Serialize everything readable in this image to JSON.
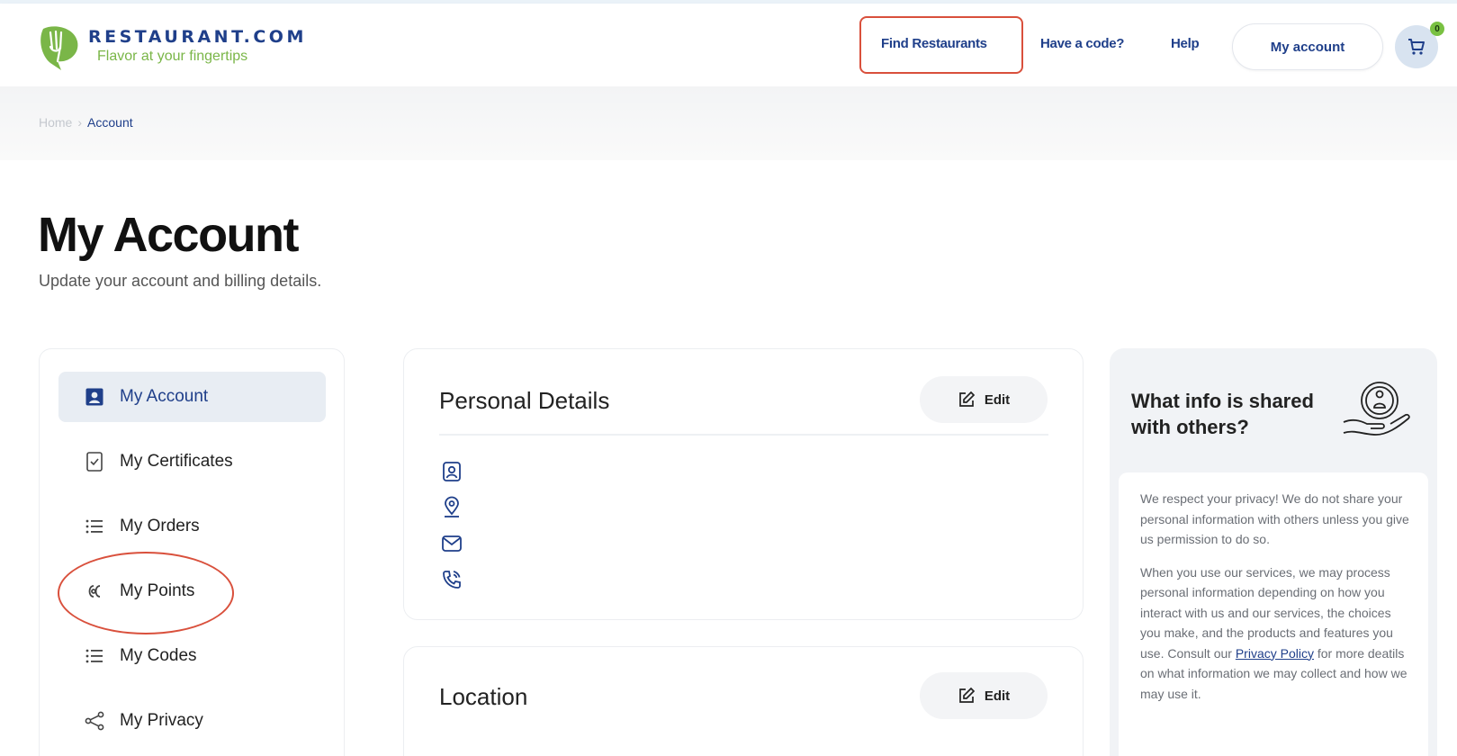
{
  "header": {
    "logo_word": "RESTAURANT.COM",
    "logo_tagline": "Flavor at your fingertips",
    "nav": {
      "find_restaurants": "Find Restaurants",
      "have_a_code": "Have a code?",
      "help": "Help",
      "my_account": "My account"
    },
    "cart_count": "0",
    "colors": {
      "brand_blue": "#1f3f8a",
      "brand_green": "#7ab648",
      "highlight_red": "#d9503c"
    }
  },
  "breadcrumb": {
    "home": "Home",
    "separator": "›",
    "current": "Account"
  },
  "page": {
    "title": "My Account",
    "subtitle": "Update your account and billing details."
  },
  "sidebar": {
    "items": [
      {
        "label": "My Account",
        "icon": "account-icon",
        "active": true
      },
      {
        "label": "My Certificates",
        "icon": "certificate-icon"
      },
      {
        "label": "My Orders",
        "icon": "list-icon"
      },
      {
        "label": "My Points",
        "icon": "points-icon"
      },
      {
        "label": "My Codes",
        "icon": "list-icon"
      },
      {
        "label": "My Privacy",
        "icon": "share-icon"
      }
    ]
  },
  "personal_details": {
    "title": "Personal Details",
    "edit_label": "Edit",
    "field_icons": [
      "person-icon",
      "location-pin-icon",
      "mail-icon",
      "phone-icon"
    ]
  },
  "location": {
    "title": "Location",
    "edit_label": "Edit"
  },
  "privacy_info": {
    "title": "What info is shared with others?",
    "paragraph1": "We respect your privacy! We do not share your personal information with others unless you give us permission to do so.",
    "paragraph2_before": "When you use our services, we may process personal information depending on how you interact with us and our services, the choices you make, and the products and features you use. Consult our",
    "paragraph2_link": "Privacy Policy",
    "paragraph2_after": "for more deatils on what information we may collect and how we may use it."
  }
}
